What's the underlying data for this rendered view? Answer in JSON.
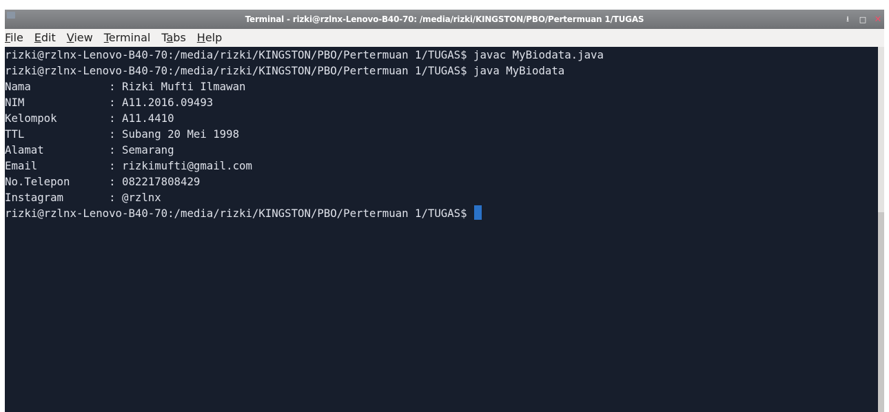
{
  "window": {
    "title": "Terminal - rizki@rzlnx-Lenovo-B40-70: /media/rizki/KINGSTON/PBO/Pertermuan 1/TUGAS",
    "controls": {
      "minimize": "⭳",
      "maximize": "□",
      "close": "✕"
    }
  },
  "menu": {
    "items": [
      {
        "key": "F",
        "rest": "ile"
      },
      {
        "key": "E",
        "rest": "dit"
      },
      {
        "key": "V",
        "rest": "iew"
      },
      {
        "key": "T",
        "rest": "erminal"
      },
      {
        "pre": "T",
        "key": "a",
        "rest": "bs"
      },
      {
        "key": "H",
        "rest": "elp"
      }
    ]
  },
  "terminal": {
    "lines": [
      "rizki@rzlnx-Lenovo-B40-70:/media/rizki/KINGSTON/PBO/Pertermuan 1/TUGAS$ javac MyBiodata.java",
      "rizki@rzlnx-Lenovo-B40-70:/media/rizki/KINGSTON/PBO/Pertermuan 1/TUGAS$ java MyBiodata",
      "Nama            : Rizki Mufti Ilmawan",
      "NIM             : A11.2016.09493",
      "Kelompok        : A11.4410",
      "TTL             : Subang 20 Mei 1998",
      "Alamat          : Semarang",
      "Email           : rizkimufti@gmail.com",
      "No.Telepon      : 082217808429",
      "Instagram       : @rzlnx"
    ],
    "prompt": "rizki@rzlnx-Lenovo-B40-70:/media/rizki/KINGSTON/PBO/Pertermuan 1/TUGAS$ "
  },
  "colors": {
    "terminal_bg": "#171e2c",
    "terminal_fg": "#dfe2ea",
    "cursor": "#2a72c8",
    "close_button": "#ef4f69"
  }
}
